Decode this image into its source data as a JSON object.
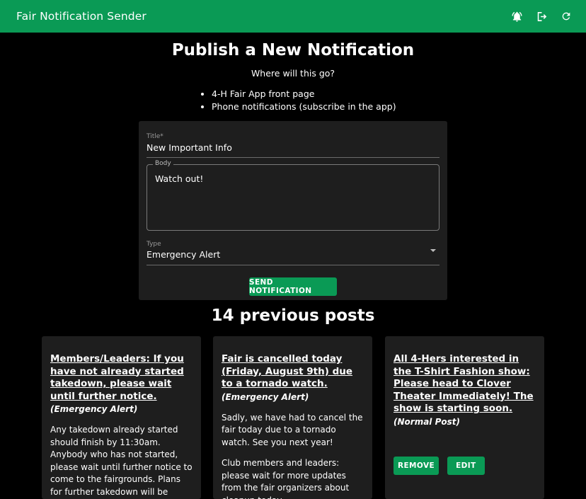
{
  "app": {
    "title": "Fair Notification Sender"
  },
  "toolbar": [
    {
      "name": "notifications-icon"
    },
    {
      "name": "logout-icon"
    },
    {
      "name": "refresh-icon"
    }
  ],
  "colors": {
    "primary": "#0a9a55",
    "card": "#1e1e1e",
    "background": "#000000"
  },
  "form": {
    "heading": "Publish a New Notification",
    "subheading": "Where will this go?",
    "destinations": [
      "4-H Fair App front page",
      "Phone notifications (subscribe in the app)"
    ],
    "title_label": "Title*",
    "title_value": "New Important Info",
    "body_label": "Body",
    "body_value": "Watch out!",
    "type_label": "Type",
    "type_value": "Emergency Alert",
    "send_label": "SEND NOTIFICATION"
  },
  "posts_heading": "14 previous posts",
  "posts": [
    {
      "title": "Members/Leaders: If you have not already started takedown, please wait until further notice.",
      "type": "(Emergency Alert)",
      "body": [
        "Any takedown already started should finish by 11:30am. Anybody who has not started, please wait until further notice to come to the fairgrounds. Plans for further takedown will be announced soon."
      ]
    },
    {
      "title": "Fair is cancelled today (Friday, August 9th) due to a tornado watch.",
      "type": "(Emergency Alert)",
      "body": [
        "Sadly, we have had to cancel the fair today due to a tornado watch. See you next year!",
        "Club members and leaders: please wait for more updates from the fair organizers about cleanup today."
      ]
    },
    {
      "title": "All 4-Hers interested in the T-Shirt Fashion show: Please head to Clover Theater Immediately! The show is starting soon.",
      "type": "(Normal Post)",
      "body": [],
      "actions": {
        "remove": "REMOVE",
        "edit": "EDIT"
      }
    }
  ]
}
